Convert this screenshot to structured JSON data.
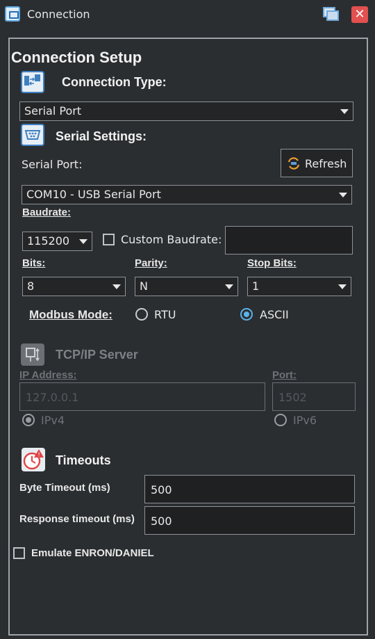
{
  "window": {
    "title": "Connection"
  },
  "panel": {
    "heading": "Connection Setup",
    "connection_type": {
      "title": "Connection Type:",
      "value": "Serial Port"
    },
    "serial": {
      "title": "Serial Settings:",
      "port_label": "Serial Port:",
      "refresh_label": "Refresh",
      "port_value": "COM10 - USB Serial Port",
      "baudrate_label": "Baudrate:",
      "baudrate_value": "115200",
      "custom_baudrate_label": "Custom Baudrate:",
      "custom_baudrate_value": "",
      "custom_baudrate_checked": false,
      "bits_label": "Bits:",
      "bits_value": "8",
      "parity_label": "Parity:",
      "parity_value": "N",
      "stopbits_label": "Stop Bits:",
      "stopbits_value": "1",
      "modbus_mode_label": "Modbus Mode:",
      "modbus_modes": [
        "RTU",
        "ASCII"
      ],
      "modbus_mode_selected": "ASCII"
    },
    "tcp": {
      "title": "TCP/IP Server",
      "ip_label": "IP Address:",
      "ip_value": "127.0.0.1",
      "port_label": "Port:",
      "port_value": "1502",
      "ipv4_label": "IPv4",
      "ipv6_label": "IPv6",
      "ip_version_selected": "IPv4",
      "enabled": false
    },
    "timeouts": {
      "title": "Timeouts",
      "byte_label": "Byte Timeout (ms)",
      "byte_value": "500",
      "response_label": "Response timeout (ms)",
      "response_value": "500"
    },
    "emulate": {
      "label": "Emulate ENRON/DANIEL",
      "checked": false
    }
  },
  "colors": {
    "background": "#2b2e31",
    "accent_radio": "#5bb2ea",
    "close_button": "#e25050",
    "border": "#9ea3a8"
  },
  "icons": [
    "app-icon",
    "restore-icon",
    "close-icon",
    "connection-type-icon",
    "serial-port-icon",
    "refresh-icon",
    "network-icon",
    "timeout-clock-icon"
  ]
}
